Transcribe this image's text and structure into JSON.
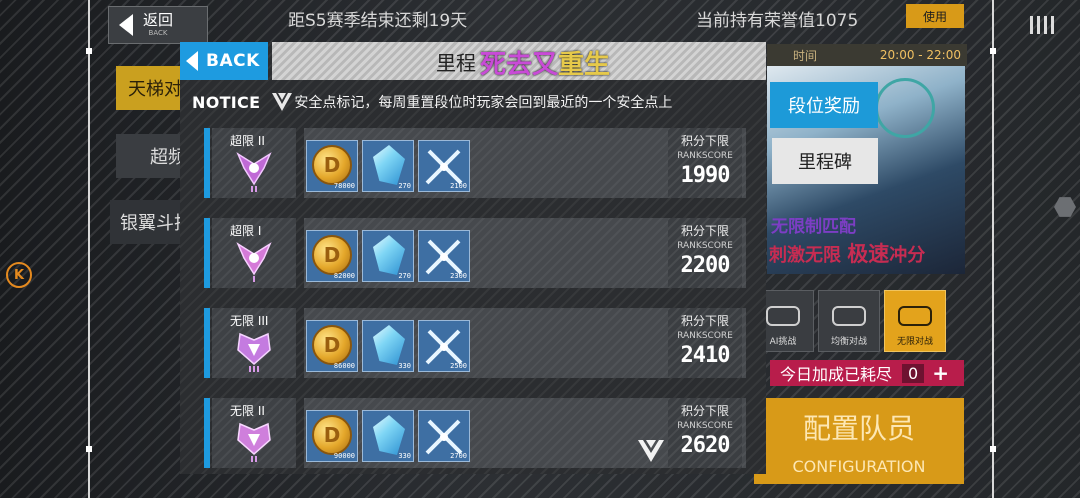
{
  "background": {
    "back_button": {
      "label": "返回",
      "sub": "BACK"
    },
    "season_text": "距S5赛季结束还剩19天",
    "honor_text": "当前持有荣誉值1075",
    "use_button": "使用",
    "tabs": [
      "天梯对",
      "超频",
      "银翼斗技"
    ],
    "time_strip": {
      "label": "时间",
      "value": "20:00 - 22:00"
    },
    "side_buttons": {
      "rank_reward": "段位奖励",
      "milestone": "里程碑"
    },
    "promo": {
      "line1": "无限制匹配",
      "line2_a": "刺激无限 ",
      "line2_b": "极速",
      "line2_c": "冲分"
    },
    "modes": [
      {
        "icon": "ai-mode-icon",
        "label": "AI挑战"
      },
      {
        "icon": "balance-mode-icon",
        "label": "均衡对战"
      },
      {
        "icon": "infinite-mode-icon",
        "label": "无限对战"
      }
    ],
    "bonus": {
      "label": "今日加成已耗尽",
      "count": "0",
      "plus": "+"
    },
    "config": {
      "zh": "配置队员",
      "en": "CONFIGURATION"
    },
    "k_badge": "K"
  },
  "modal": {
    "back_label": "BACK",
    "title": "里程",
    "overlay_caption": {
      "part1": "死去又",
      "part2": "重生"
    },
    "notice_label": "NOTICE",
    "notice_text": "安全点标记，每周重置段位时玩家会回到最近的一个安全点上",
    "score_label": "积分下限",
    "score_en": "RANKSCORE",
    "tiers": [
      {
        "name": "超限 II",
        "rewards": [
          "78000",
          "270",
          "2100"
        ],
        "score": "1990",
        "safe_point": false
      },
      {
        "name": "超限 I",
        "rewards": [
          "82000",
          "270",
          "2300"
        ],
        "score": "2200",
        "safe_point": false
      },
      {
        "name": "无限 III",
        "rewards": [
          "86000",
          "330",
          "2500"
        ],
        "score": "2410",
        "safe_point": false
      },
      {
        "name": "无限 II",
        "rewards": [
          "90000",
          "330",
          "2700"
        ],
        "score": "2620",
        "safe_point": true
      }
    ],
    "coin_glyph": "D"
  },
  "colors": {
    "accent_blue": "#1e9be0",
    "gold": "#d89a18",
    "pink": "#b81d4b"
  }
}
